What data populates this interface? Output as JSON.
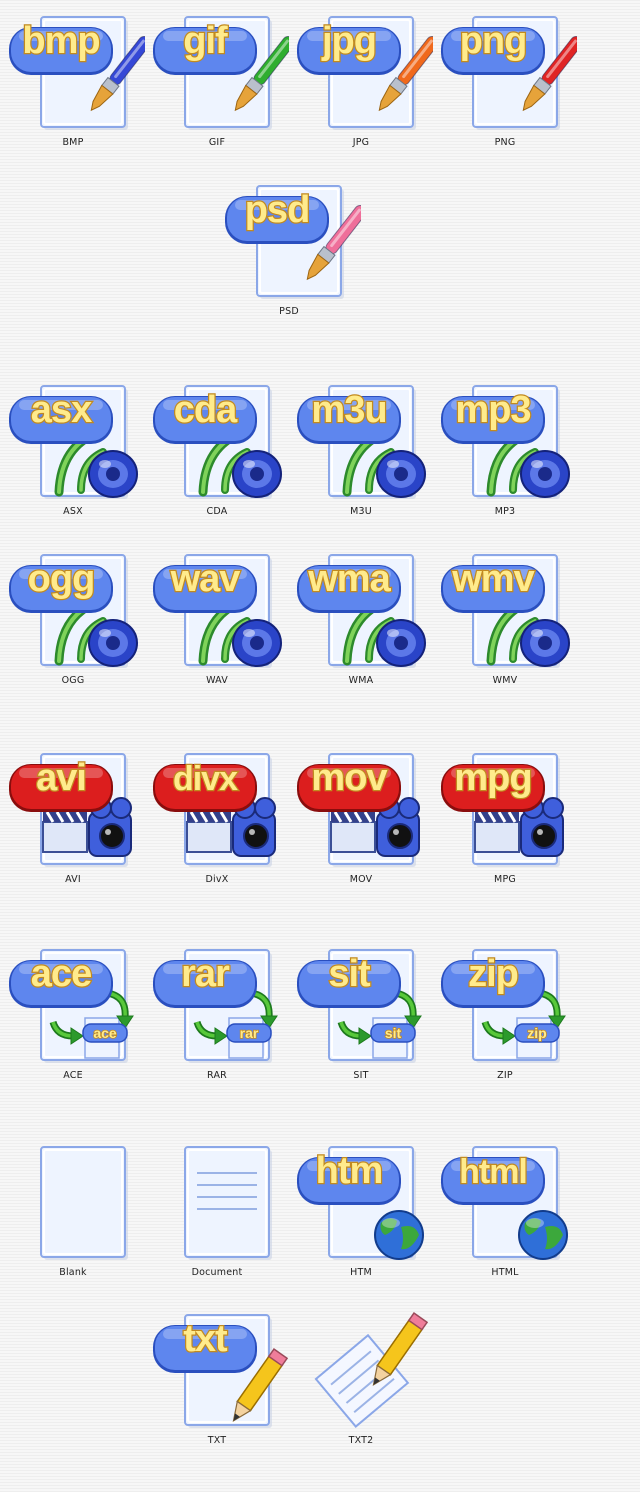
{
  "colors": {
    "badge_blue": "#5e86ee",
    "badge_red": "#dc1e1e",
    "label_fill": "#ffeb8c",
    "label_stroke": "#c28a1f",
    "page_fill": "#eef4ff",
    "page_border": "#8ba7e8"
  },
  "icons": [
    {
      "label": "BMP",
      "ext": "bmp",
      "kind": "image",
      "accent": "#3548d6",
      "badge": "blue"
    },
    {
      "label": "GIF",
      "ext": "gif",
      "kind": "image",
      "accent": "#2fae2f",
      "badge": "blue"
    },
    {
      "label": "JPG",
      "ext": "jpg",
      "kind": "image",
      "accent": "#f0691c",
      "badge": "blue"
    },
    {
      "label": "PNG",
      "ext": "png",
      "kind": "image",
      "accent": "#e02424",
      "badge": "blue"
    },
    {
      "label": "PSD",
      "ext": "psd",
      "kind": "image",
      "accent": "#ef6f9a",
      "badge": "blue"
    },
    {
      "label": "ASX",
      "ext": "asx",
      "kind": "audio",
      "badge": "blue"
    },
    {
      "label": "CDA",
      "ext": "cda",
      "kind": "audio",
      "badge": "blue"
    },
    {
      "label": "M3U",
      "ext": "m3u",
      "kind": "audio",
      "badge": "blue"
    },
    {
      "label": "MP3",
      "ext": "mp3",
      "kind": "audio",
      "badge": "blue"
    },
    {
      "label": "OGG",
      "ext": "ogg",
      "kind": "audio",
      "badge": "blue"
    },
    {
      "label": "WAV",
      "ext": "wav",
      "kind": "audio",
      "badge": "blue"
    },
    {
      "label": "WMA",
      "ext": "wma",
      "kind": "audio",
      "badge": "blue"
    },
    {
      "label": "WMV",
      "ext": "wmv",
      "kind": "audio",
      "badge": "blue"
    },
    {
      "label": "AVI",
      "ext": "avi",
      "kind": "video",
      "badge": "red"
    },
    {
      "label": "DivX",
      "ext": "divx",
      "kind": "video",
      "badge": "red"
    },
    {
      "label": "MOV",
      "ext": "mov",
      "kind": "video",
      "badge": "red"
    },
    {
      "label": "MPG",
      "ext": "mpg",
      "kind": "video",
      "badge": "red"
    },
    {
      "label": "ACE",
      "ext": "ace",
      "kind": "archive",
      "badge": "blue"
    },
    {
      "label": "RAR",
      "ext": "rar",
      "kind": "archive",
      "badge": "blue"
    },
    {
      "label": "SIT",
      "ext": "sit",
      "kind": "archive",
      "badge": "blue"
    },
    {
      "label": "ZIP",
      "ext": "zip",
      "kind": "archive",
      "badge": "blue"
    },
    {
      "label": "Blank",
      "ext": "",
      "kind": "blank",
      "badge": "none"
    },
    {
      "label": "Document",
      "ext": "",
      "kind": "document",
      "badge": "none"
    },
    {
      "label": "HTM",
      "ext": "htm",
      "kind": "web",
      "badge": "blue"
    },
    {
      "label": "HTML",
      "ext": "html",
      "kind": "web",
      "badge": "blue"
    },
    {
      "label": "TXT",
      "ext": "txt",
      "kind": "text",
      "badge": "blue"
    },
    {
      "label": "TXT2",
      "ext": "",
      "kind": "text2",
      "badge": "none"
    }
  ]
}
